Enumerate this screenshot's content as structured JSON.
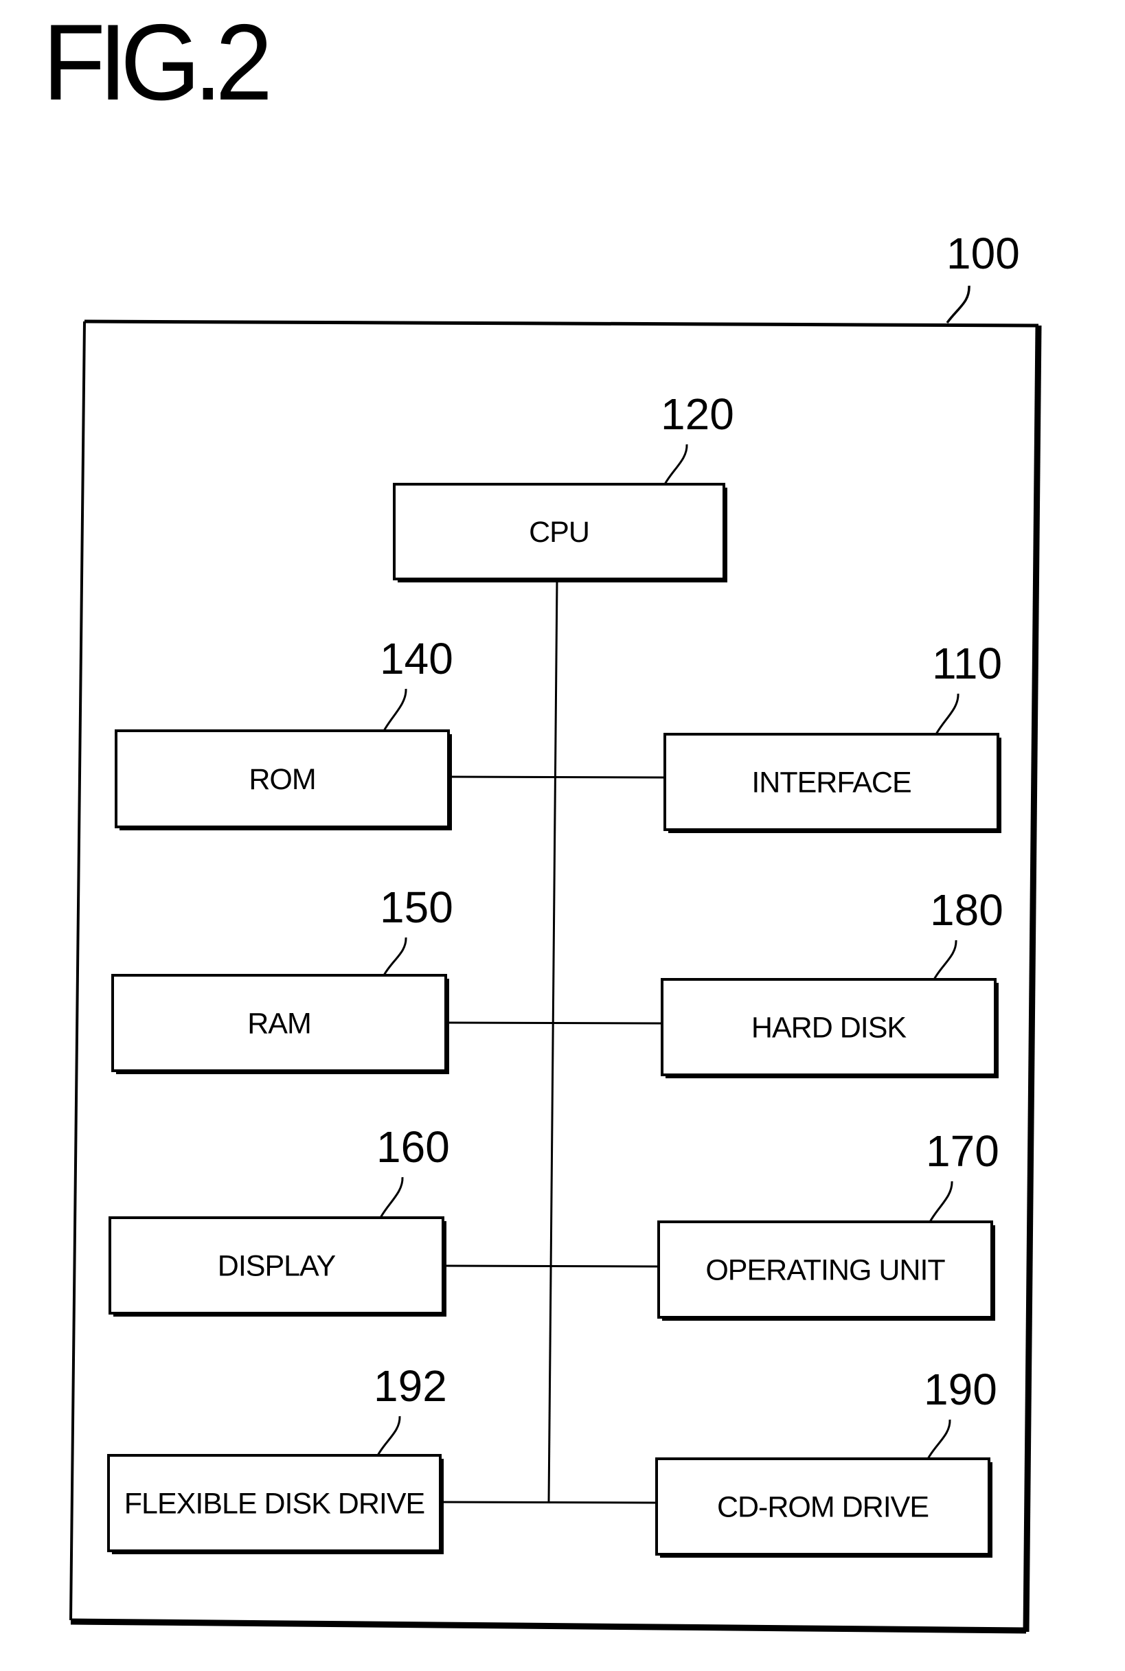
{
  "figure": {
    "title": "FIG.2",
    "system": {
      "ref": "100"
    }
  },
  "blocks": [
    {
      "id": "cpu",
      "label": "CPU",
      "ref": "120"
    },
    {
      "id": "rom",
      "label": "ROM",
      "ref": "140"
    },
    {
      "id": "interface",
      "label": "INTERFACE",
      "ref": "110"
    },
    {
      "id": "ram",
      "label": "RAM",
      "ref": "150"
    },
    {
      "id": "hard-disk",
      "label": "HARD DISK",
      "ref": "180"
    },
    {
      "id": "display",
      "label": "DISPLAY",
      "ref": "160"
    },
    {
      "id": "operating-unit",
      "label": "OPERATING UNIT",
      "ref": "170"
    },
    {
      "id": "flexible-disk-drive",
      "label": "FLEXIBLE DISK DRIVE",
      "ref": "192"
    },
    {
      "id": "cd-rom-drive",
      "label": "CD-ROM DRIVE",
      "ref": "190"
    }
  ],
  "connections": [
    [
      "cpu",
      "bus"
    ],
    [
      "rom",
      "bus"
    ],
    [
      "interface",
      "bus"
    ],
    [
      "ram",
      "bus"
    ],
    [
      "hard-disk",
      "bus"
    ],
    [
      "display",
      "bus"
    ],
    [
      "operating-unit",
      "bus"
    ],
    [
      "flexible-disk-drive",
      "bus"
    ],
    [
      "cd-rom-drive",
      "bus"
    ]
  ]
}
